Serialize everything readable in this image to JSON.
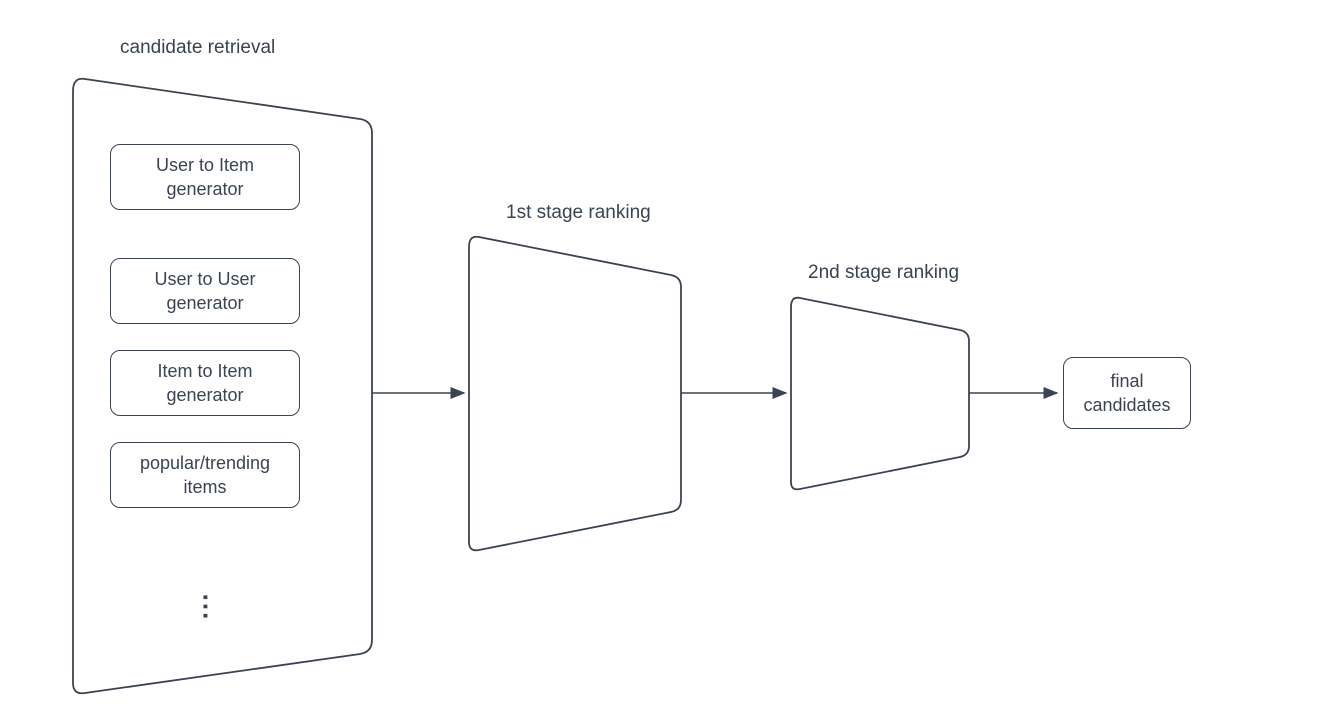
{
  "titles": {
    "candidate_retrieval": "candidate retrieval",
    "stage1": "1st stage ranking",
    "stage2": "2nd stage ranking"
  },
  "generators": {
    "g0": "User to Item\ngenerator",
    "g1": "User to User\ngenerator",
    "g2": "Item to Item\ngenerator",
    "g3": "popular/trending\nitems"
  },
  "final": "final\ncandidates",
  "ellipsis": "..."
}
